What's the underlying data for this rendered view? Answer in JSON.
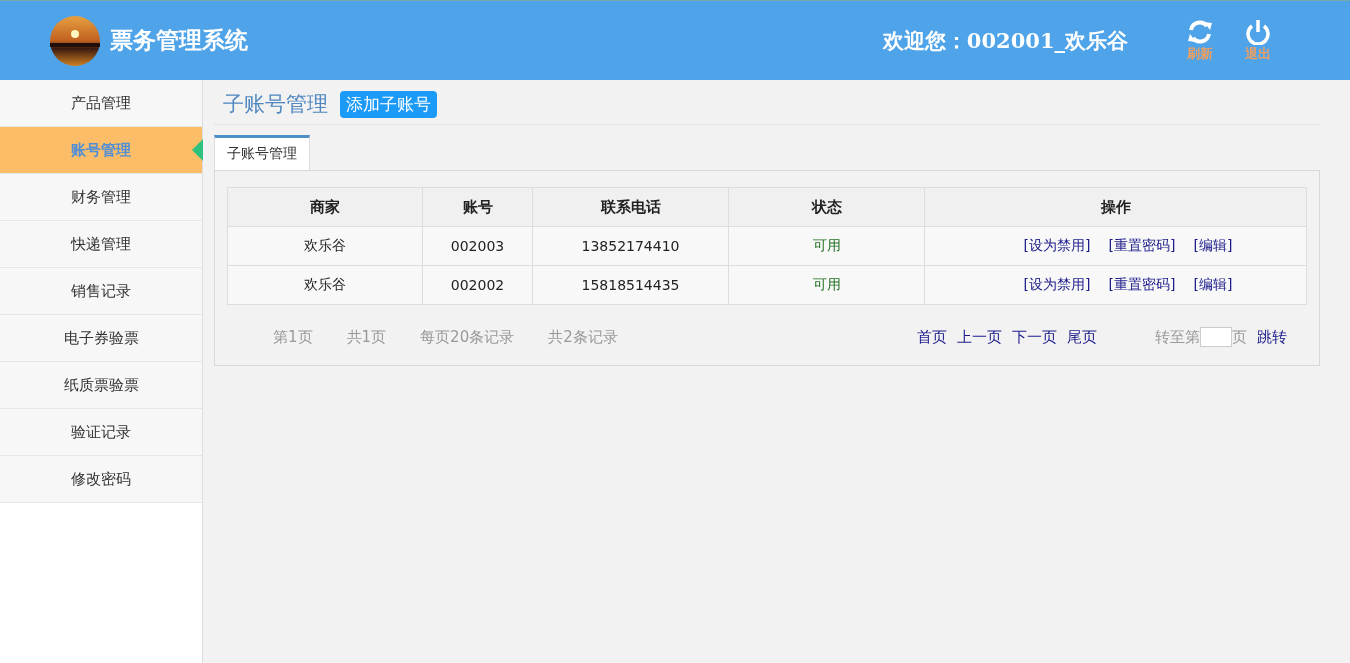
{
  "header": {
    "title": "票务管理系统",
    "welcome": "欢迎您：002001_欢乐谷",
    "actions": [
      {
        "kind": "refresh",
        "label": "刷新"
      },
      {
        "kind": "logout",
        "label": "退出"
      }
    ]
  },
  "sidebar": {
    "items": [
      {
        "label": "产品管理",
        "selected": false
      },
      {
        "label": "账号管理",
        "selected": true
      },
      {
        "label": "财务管理",
        "selected": false
      },
      {
        "label": "快递管理",
        "selected": false
      },
      {
        "label": "销售记录",
        "selected": false
      },
      {
        "label": "电子券验票",
        "selected": false
      },
      {
        "label": "纸质票验票",
        "selected": false
      },
      {
        "label": "验证记录",
        "selected": false
      },
      {
        "label": "修改密码",
        "selected": false
      }
    ]
  },
  "page": {
    "title": "子账号管理",
    "add_button": "添加子账号"
  },
  "tabs": [
    {
      "label": "子账号管理",
      "selected": true
    }
  ],
  "table": {
    "columns": [
      "商家",
      "账号",
      "联系电话",
      "状态",
      "操作"
    ],
    "rows": [
      {
        "merchant": "欢乐谷",
        "account": "002003",
        "phone": "13852174410",
        "status": "可用",
        "actions": [
          "[设为禁用]",
          "[重置密码]",
          "[编辑]"
        ]
      },
      {
        "merchant": "欢乐谷",
        "account": "002002",
        "phone": "15818514435",
        "status": "可用",
        "actions": [
          "[设为禁用]",
          "[重置密码]",
          "[编辑]"
        ]
      }
    ]
  },
  "pagination": {
    "info": [
      "第1页",
      "共1页",
      "每页20条记录",
      "共2条记录"
    ],
    "links": [
      "首页",
      "上一页",
      "下一页",
      "尾页"
    ],
    "goto_before": "转至第",
    "goto_after": "页",
    "goto_button": "跳转"
  }
}
